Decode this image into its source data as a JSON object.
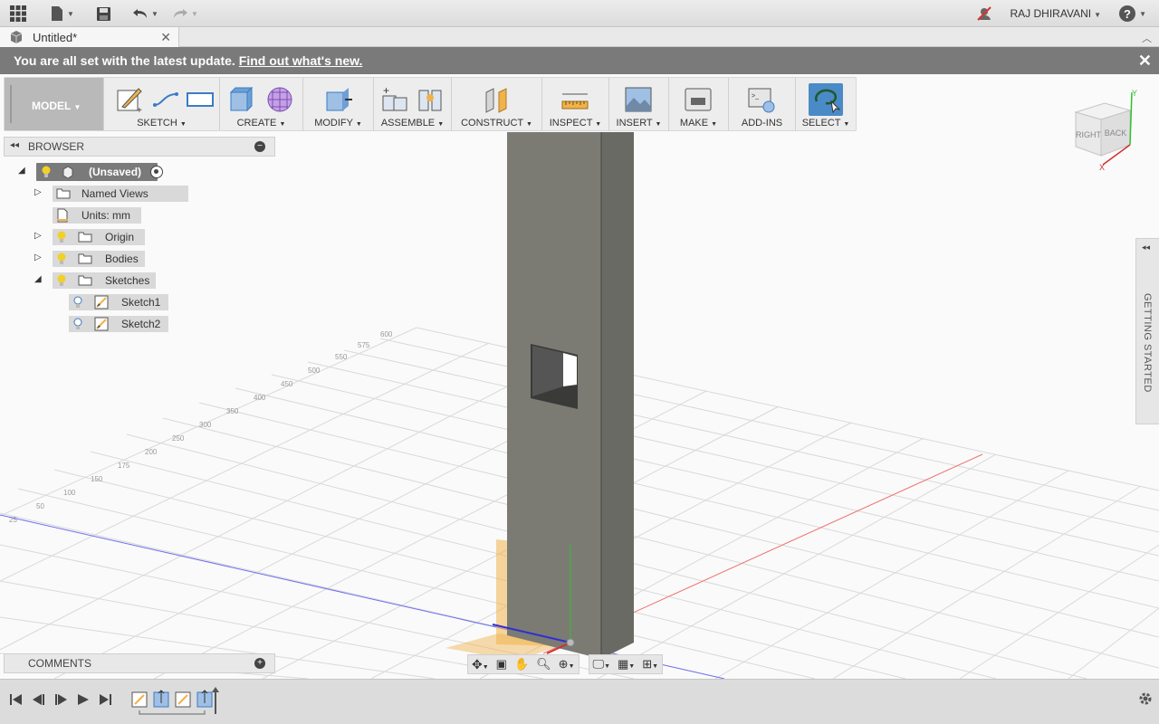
{
  "app": {
    "user": "RAJ DHIRAVANI",
    "tab_title": "Untitled*"
  },
  "notification": {
    "message": "You are all set with the latest update.",
    "link": "Find out what's new."
  },
  "toolbar": {
    "workspace": "MODEL",
    "groups": [
      "SKETCH",
      "CREATE",
      "MODIFY",
      "ASSEMBLE",
      "CONSTRUCT",
      "INSPECT",
      "INSERT",
      "MAKE",
      "ADD-INS",
      "SELECT"
    ]
  },
  "browser": {
    "title": "BROWSER",
    "root": "(Unsaved)",
    "items": [
      {
        "label": "Named Views"
      },
      {
        "label": "Units: mm"
      },
      {
        "label": "Origin"
      },
      {
        "label": "Bodies"
      },
      {
        "label": "Sketches"
      },
      {
        "label": "Sketch1"
      },
      {
        "label": "Sketch2"
      }
    ]
  },
  "comments": {
    "label": "COMMENTS"
  },
  "getting_started": "GETTING STARTED",
  "viewcube": {
    "faces": [
      "RIGHT",
      "BACK"
    ],
    "axes": [
      "X",
      "Y"
    ]
  },
  "colors": {
    "selected": "#4a8ac6",
    "body": "#7a7a72",
    "sketch_plane": "#f0b24a",
    "notification": "#7a7a7a"
  }
}
